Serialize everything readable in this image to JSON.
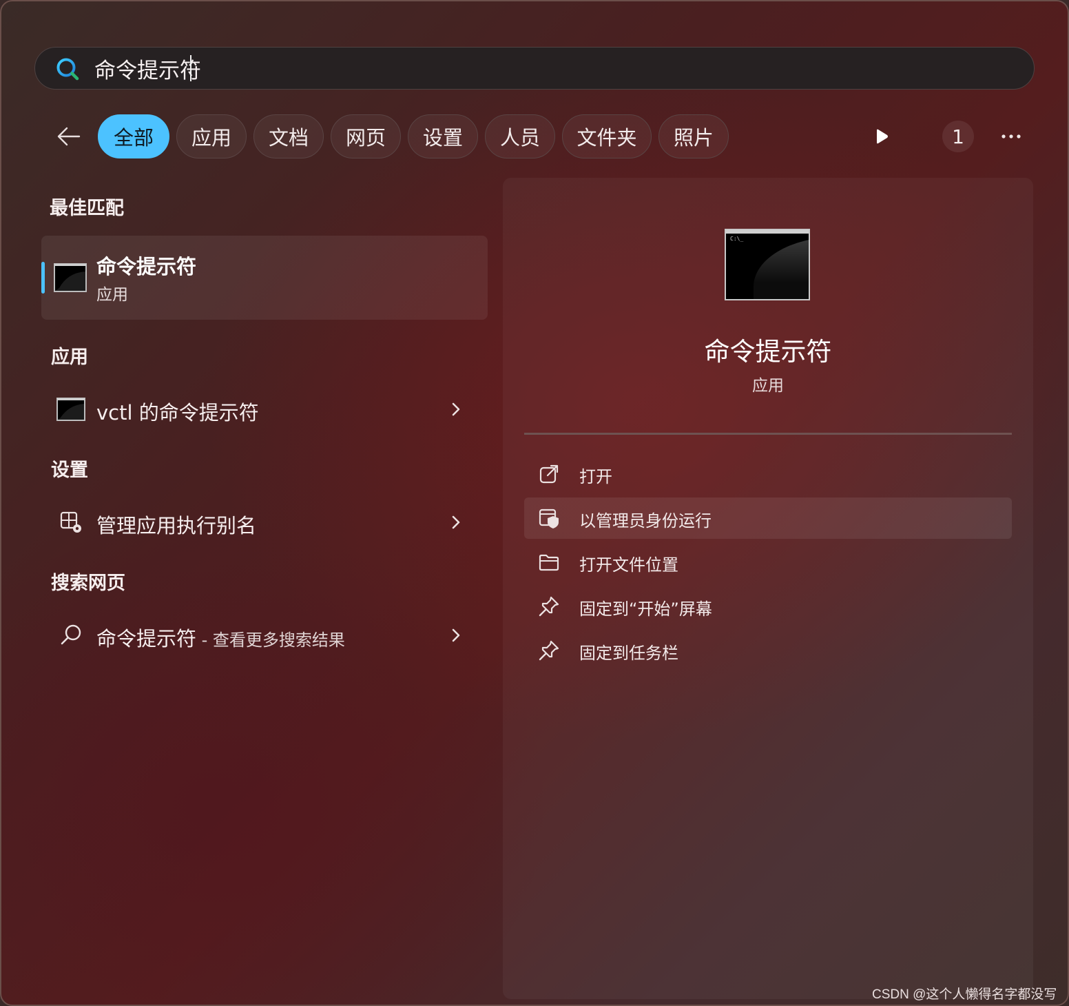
{
  "search": {
    "query": "命令提示符",
    "icon": "search-icon",
    "accent_color": "#4cc2ff"
  },
  "filters": {
    "back_icon": "arrow-left-icon",
    "chips": [
      "全部",
      "应用",
      "文档",
      "网页",
      "设置",
      "人员",
      "文件夹",
      "照片"
    ],
    "active_index": 0,
    "play_icon": "play-icon",
    "count": "1",
    "more_icon": "more-icon"
  },
  "best_match": {
    "heading": "最佳匹配",
    "title": "命令提示符",
    "subtitle": "应用",
    "icon": "cmd-icon"
  },
  "apps": {
    "heading": "应用",
    "items": [
      {
        "label": "vctl 的命令提示符",
        "icon": "cmd-icon"
      }
    ]
  },
  "settings": {
    "heading": "设置",
    "items": [
      {
        "label": "管理应用执行别名",
        "icon": "app-settings-icon"
      }
    ]
  },
  "web": {
    "heading": "搜索网页",
    "items": [
      {
        "label": "命令提示符",
        "suffix": " - 查看更多搜索结果",
        "icon": "search-icon"
      }
    ]
  },
  "detail": {
    "title": "命令提示符",
    "subtitle": "应用",
    "icon_prompt": "C:\\_",
    "actions": [
      {
        "label": "打开",
        "icon": "open-external-icon"
      },
      {
        "label": "以管理员身份运行",
        "icon": "shield-admin-icon"
      },
      {
        "label": "打开文件位置",
        "icon": "folder-icon"
      },
      {
        "label": "固定到“开始”屏幕",
        "icon": "pin-icon"
      },
      {
        "label": "固定到任务栏",
        "icon": "pin-icon"
      }
    ],
    "hovered_index": 1
  },
  "watermark": "CSDN @这个人懒得名字都没写"
}
